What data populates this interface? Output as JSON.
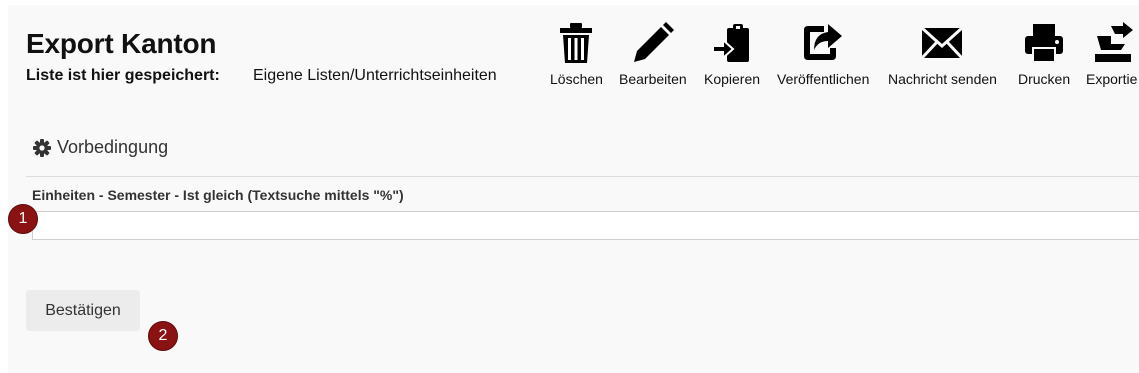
{
  "header": {
    "title": "Export Kanton",
    "saved_label": "Liste ist hier gespeichert:",
    "saved_value": "Eigene Listen/Unterrichtseinheiten"
  },
  "toolbar": [
    {
      "label": "Löschen",
      "icon": "trash-icon"
    },
    {
      "label": "Bearbeiten",
      "icon": "pencil-icon"
    },
    {
      "label": "Kopieren",
      "icon": "clipboard-copy-icon"
    },
    {
      "label": "Veröffentlichen",
      "icon": "share-icon"
    },
    {
      "label": "Nachricht senden",
      "icon": "envelope-icon"
    },
    {
      "label": "Drucken",
      "icon": "printer-icon"
    },
    {
      "label": "Exportie",
      "icon": "export-icon"
    }
  ],
  "precondition": {
    "heading": "Vorbedingung",
    "icon": "gear-icon"
  },
  "filter": {
    "label": "Einheiten - Semester - Ist gleich (Textsuche mittels \"%\")",
    "value": ""
  },
  "confirm_button": "Bestätigen",
  "markers": [
    "1",
    "2"
  ],
  "colors": {
    "marker": "#8b1212",
    "panel_background": "#f9f9f9",
    "button_background": "#ececec"
  }
}
